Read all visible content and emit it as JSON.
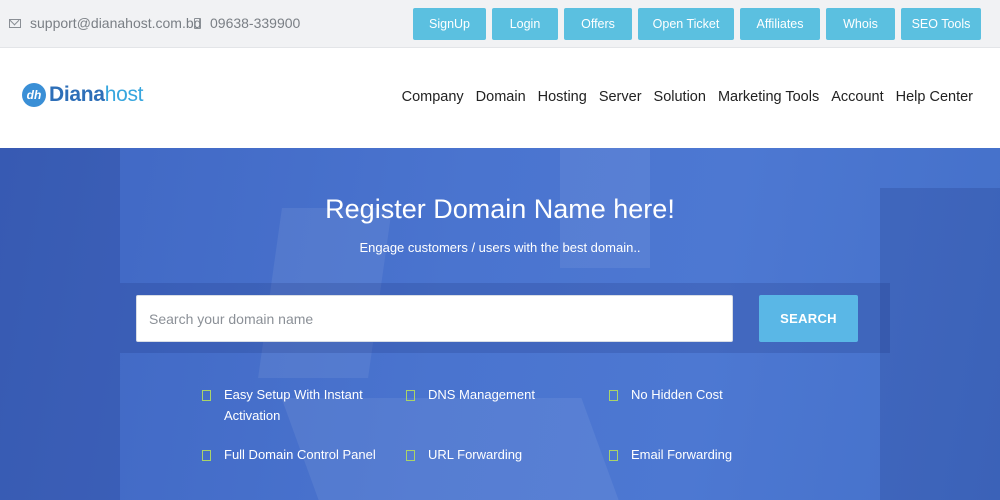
{
  "topbar": {
    "email": "support@dianahost.com.bd",
    "phone": "09638-339900",
    "buttons": [
      "SignUp",
      "Login",
      "Offers",
      "Open Ticket",
      "Affiliates",
      "Whois",
      "SEO Tools"
    ]
  },
  "header": {
    "logo_part1": "Diana",
    "logo_part2": "host",
    "logo_mark": "dh",
    "nav": [
      "Company",
      "Domain",
      "Hosting",
      "Server",
      "Solution",
      "Marketing Tools",
      "Account",
      "Help Center"
    ]
  },
  "hero": {
    "title": "Register Domain Name here!",
    "subtitle": "Engage customers / users with the best domain..",
    "search_placeholder": "Search your domain name",
    "search_button": "SEARCH",
    "features": [
      "Easy Setup With Instant Activation",
      "DNS Management",
      "No Hidden Cost",
      "Full Domain Control Panel",
      "URL Forwarding",
      "Email Forwarding"
    ]
  },
  "colors": {
    "accent": "#5bc0e0",
    "hero_bg": "#4a74cf",
    "check": "#a9d36a"
  },
  "icons": [
    "envelope-icon",
    "phone-icon",
    "check-icon"
  ]
}
